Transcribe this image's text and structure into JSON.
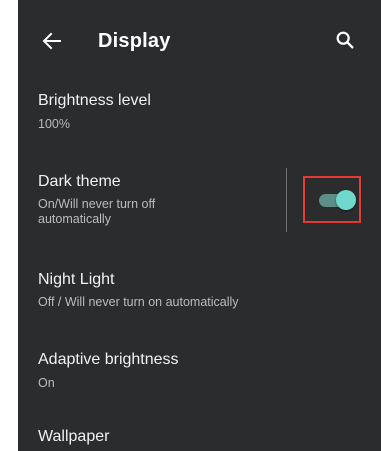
{
  "app_bar": {
    "title": "Display",
    "back_icon": "arrow-left-icon",
    "search_icon": "search-icon"
  },
  "settings": [
    {
      "title": "Brightness level",
      "subtitle": "100%"
    },
    {
      "title": "Dark theme",
      "subtitle_line1": "On/Will never turn off",
      "subtitle_line2": "automatically",
      "toggle_on": true
    },
    {
      "title": "Night Light",
      "subtitle": "Off / Will never turn on automatically"
    },
    {
      "title": "Adaptive brightness",
      "subtitle": "On"
    },
    {
      "title": "Wallpaper"
    }
  ],
  "colors": {
    "background": "#2b2c2e",
    "accent": "#6fd9cd",
    "highlight_box": "#e53935"
  }
}
